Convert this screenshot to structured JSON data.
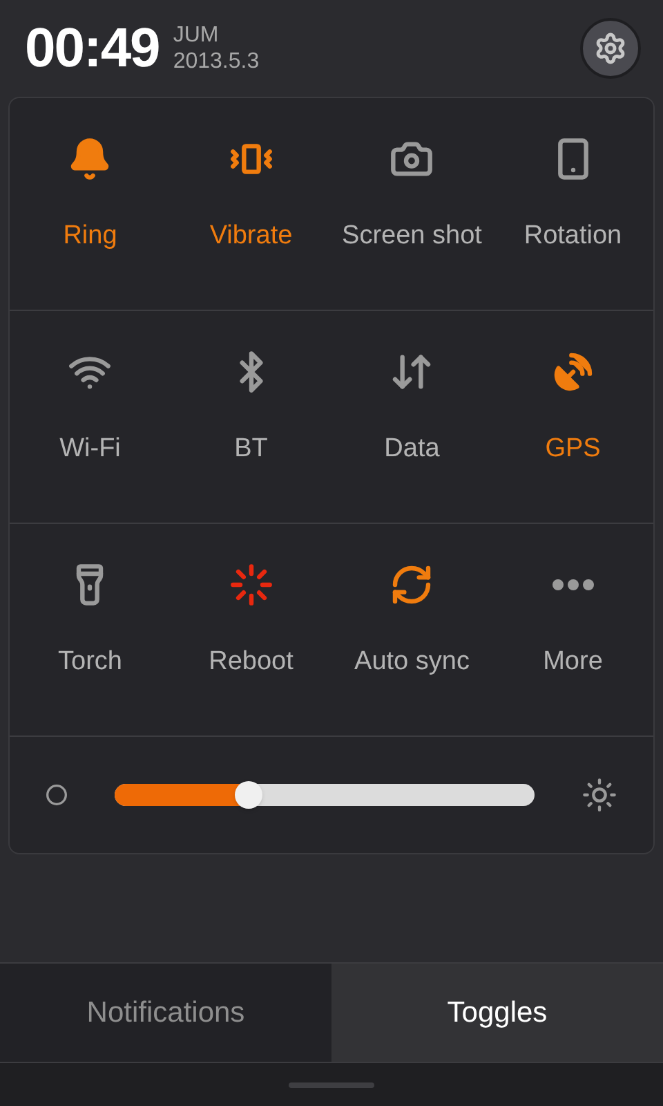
{
  "status": {
    "time": "00:49",
    "day": "JUM",
    "date": "2013.5.3"
  },
  "toggles": [
    {
      "kind": "ring",
      "label": "Ring",
      "on": true
    },
    {
      "kind": "vibrate",
      "label": "Vibrate",
      "on": true
    },
    {
      "kind": "screenshot",
      "label": "Screen shot",
      "on": false
    },
    {
      "kind": "rotation",
      "label": "Rotation",
      "on": false
    },
    {
      "kind": "wifi",
      "label": "Wi-Fi",
      "on": false
    },
    {
      "kind": "bluetooth",
      "label": "BT",
      "on": false
    },
    {
      "kind": "data",
      "label": "Data",
      "on": false
    },
    {
      "kind": "gps",
      "label": "GPS",
      "on": true
    },
    {
      "kind": "torch",
      "label": "Torch",
      "on": false
    },
    {
      "kind": "reboot",
      "label": "Reboot",
      "on": false
    },
    {
      "kind": "autosync",
      "label": "Auto sync",
      "on": false
    },
    {
      "kind": "more",
      "label": "More",
      "on": false
    }
  ],
  "brightness": {
    "level": 0.32
  },
  "tabs": [
    {
      "label": "Notifications",
      "selected": false
    },
    {
      "label": "Toggles",
      "selected": true
    }
  ]
}
